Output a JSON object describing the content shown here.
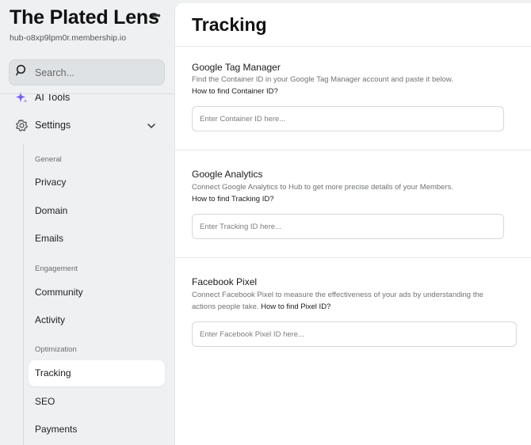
{
  "sidebar": {
    "brand": "The Plated Lens",
    "url": "hub-o8xp9lpm0r.membership.io",
    "search_placeholder": "Search...",
    "ai_tools_label": "AI Tools",
    "settings_label": "Settings",
    "groups": {
      "general": "General",
      "engagement": "Engagement",
      "optimization": "Optimization"
    },
    "items": {
      "privacy": "Privacy",
      "domain": "Domain",
      "emails": "Emails",
      "community": "Community",
      "activity": "Activity",
      "tracking": "Tracking",
      "seo": "SEO",
      "payments": "Payments"
    }
  },
  "main": {
    "title": "Tracking",
    "gtm": {
      "title": "Google Tag Manager",
      "desc": "Find the Container ID in your Google Tag Manager account and paste it below.",
      "link": "How to find Container ID?",
      "placeholder": "Enter Container ID here..."
    },
    "ga": {
      "title": "Google Analytics",
      "desc": "Connect Google Analytics to Hub to get more precise details of your Members.",
      "link": "How to find Tracking ID?",
      "placeholder": "Enter Tracking ID here..."
    },
    "fb": {
      "title": "Facebook Pixel",
      "desc_line1": "Connect Facebook Pixel to measure the effectiveness of your ads by understanding the",
      "desc_line2": "actions people take.",
      "link": "How to find Pixel ID?",
      "placeholder": "Enter Facebook Pixel ID here..."
    }
  }
}
